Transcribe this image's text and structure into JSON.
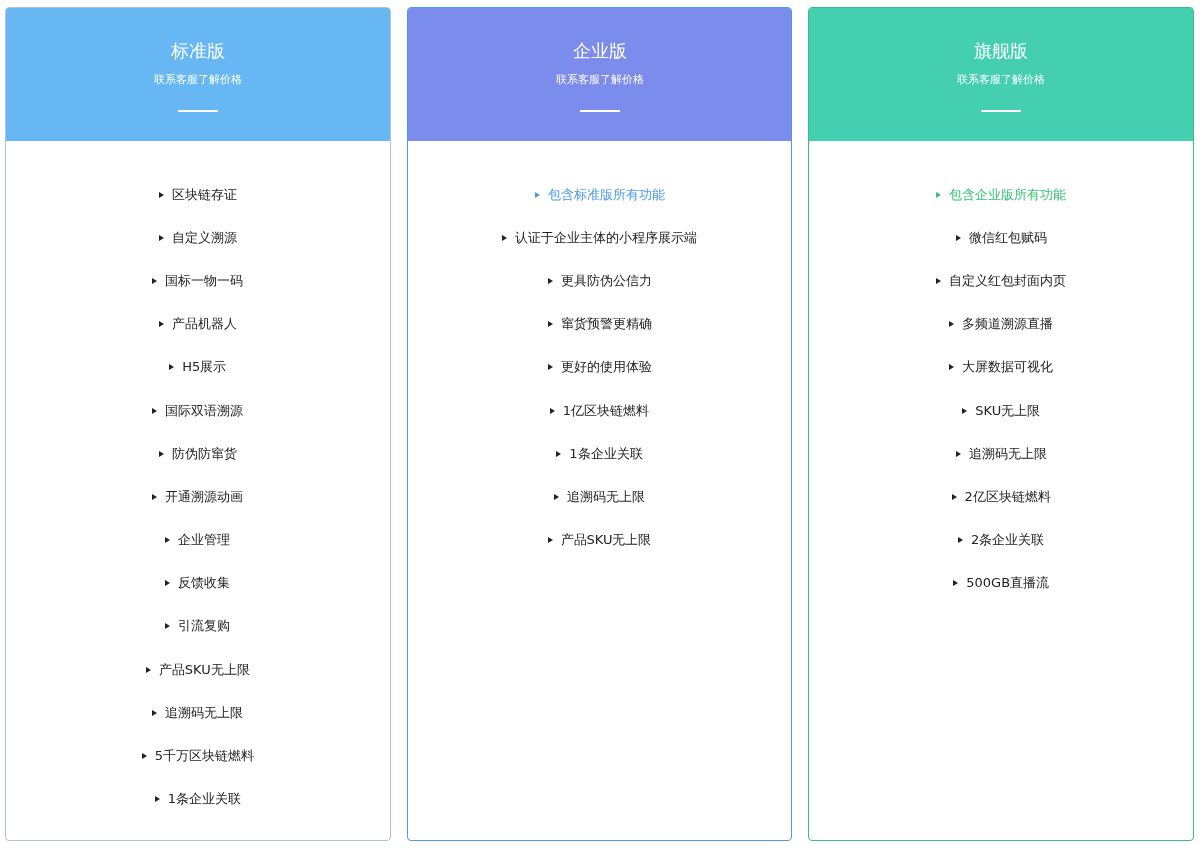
{
  "plans": [
    {
      "title": "标准版",
      "subtitle": "联系客服了解价格",
      "color": "#66b7f3",
      "border": {
        "color": "#b3c3d1"
      },
      "features": [
        {
          "text": "区块链存证",
          "highlighted": false
        },
        {
          "text": "自定义溯源",
          "highlighted": false
        },
        {
          "text": "国标一物一码",
          "highlighted": false
        },
        {
          "text": "产品机器人",
          "highlighted": false
        },
        {
          "text": "H5展示",
          "highlighted": false
        },
        {
          "text": "国际双语溯源",
          "highlighted": false
        },
        {
          "text": "防伪防窜货",
          "highlighted": false
        },
        {
          "text": "开通溯源动画",
          "highlighted": false
        },
        {
          "text": "企业管理",
          "highlighted": false
        },
        {
          "text": "反馈收集",
          "highlighted": false
        },
        {
          "text": "引流复购",
          "highlighted": false
        },
        {
          "text": "产品SKU无上限",
          "highlighted": false
        },
        {
          "text": "追溯码无上限",
          "highlighted": false
        },
        {
          "text": "5千万区块链燃料",
          "highlighted": false
        },
        {
          "text": "1条企业关联",
          "highlighted": false
        }
      ]
    },
    {
      "title": "企业版",
      "subtitle": "联系客服了解价格",
      "color": "#7b8cec",
      "border": {
        "color": "#4a9be8"
      },
      "features": [
        {
          "text": "包含标准版所有功能",
          "highlighted": true
        },
        {
          "text": "认证于企业主体的小程序展示端",
          "highlighted": false
        },
        {
          "text": "更具防伪公信力",
          "highlighted": false
        },
        {
          "text": "窜货预警更精确",
          "highlighted": false
        },
        {
          "text": "更好的使用体验",
          "highlighted": false
        },
        {
          "text": "1亿区块链燃料",
          "highlighted": false
        },
        {
          "text": "1条企业关联",
          "highlighted": false
        },
        {
          "text": "追溯码无上限",
          "highlighted": false
        },
        {
          "text": "产品SKU无上限",
          "highlighted": false
        }
      ]
    },
    {
      "title": "旗舰版",
      "subtitle": "联系客服了解价格",
      "color": "#43cfb0",
      "border": {
        "color": "#36c078"
      },
      "features": [
        {
          "text": "包含企业版所有功能",
          "highlighted": true
        },
        {
          "text": "微信红包赋码",
          "highlighted": false
        },
        {
          "text": "自定义红包封面内页",
          "highlighted": false
        },
        {
          "text": "多频道溯源直播",
          "highlighted": false
        },
        {
          "text": "大屏数据可视化",
          "highlighted": false
        },
        {
          "text": "SKU无上限",
          "highlighted": false
        },
        {
          "text": "追溯码无上限",
          "highlighted": false
        },
        {
          "text": "2亿区块链燃料",
          "highlighted": false
        },
        {
          "text": "2条企业关联",
          "highlighted": false
        },
        {
          "text": "500GB直播流",
          "highlighted": false
        }
      ]
    }
  ]
}
